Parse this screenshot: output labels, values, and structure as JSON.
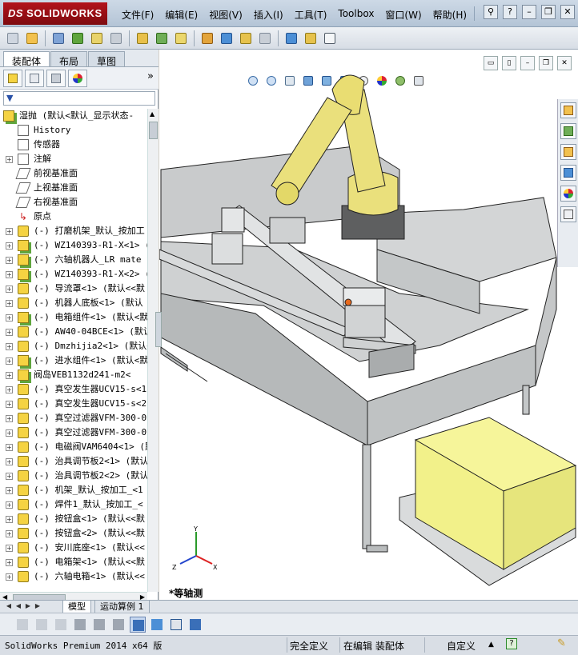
{
  "app": {
    "logo_text": "SOLIDWORKS",
    "logo_ds": "DS"
  },
  "menu": [
    "文件(F)",
    "编辑(E)",
    "视图(V)",
    "插入(I)",
    "工具(T)",
    "Toolbox",
    "窗口(W)",
    "帮助(H)"
  ],
  "panel": {
    "tabs": [
      "装配体",
      "布局",
      "草图"
    ],
    "active_tab": 0
  },
  "tree": {
    "root": "湿抛 (默认<默认_显示状态-",
    "items": [
      {
        "label": "History",
        "icon": "history-icon",
        "expand": ""
      },
      {
        "label": "传感器",
        "icon": "sensor-icon",
        "expand": ""
      },
      {
        "label": "注解",
        "icon": "annotation-icon",
        "expand": "+"
      },
      {
        "label": "前视基准面",
        "icon": "plane-icon",
        "expand": ""
      },
      {
        "label": "上视基准面",
        "icon": "plane-icon",
        "expand": ""
      },
      {
        "label": "右视基准面",
        "icon": "plane-icon",
        "expand": ""
      },
      {
        "label": "原点",
        "icon": "origin-icon",
        "expand": ""
      },
      {
        "label": "(-) 打磨机架_默认_按加工",
        "icon": "part-icon",
        "expand": "+"
      },
      {
        "label": "(-) WZ140393-R1-X<1> (默",
        "icon": "assembly-icon",
        "expand": "+"
      },
      {
        "label": "(-) 六轴机器人_LR mate",
        "icon": "assembly-icon",
        "expand": "+"
      },
      {
        "label": "(-) WZ140393-R1-X<2> (默",
        "icon": "assembly-icon",
        "expand": "+"
      },
      {
        "label": "(-) 导流罩<1> (默认<<默",
        "icon": "part-icon",
        "expand": "+"
      },
      {
        "label": "(-) 机器人底板<1> (默认",
        "icon": "part-icon",
        "expand": "+"
      },
      {
        "label": "(-) 电箱组件<1> (默认<默",
        "icon": "assembly-icon",
        "expand": "+"
      },
      {
        "label": "(-) AW40-04BCE<1> (默认",
        "icon": "part-icon",
        "expand": "+"
      },
      {
        "label": "(-) Dmzhijia2<1> (默认<",
        "icon": "part-icon",
        "expand": "+"
      },
      {
        "label": "(-) 进水组件<1> (默认<默",
        "icon": "assembly-icon",
        "expand": "+"
      },
      {
        "label": "阀岛VEB1132d241-m2<",
        "icon": "assembly-icon",
        "expand": "+"
      },
      {
        "label": "(-) 真空发生器UCV15-s<1",
        "icon": "part-icon",
        "expand": "+"
      },
      {
        "label": "(-) 真空发生器UCV15-s<2",
        "icon": "part-icon",
        "expand": "+"
      },
      {
        "label": "(-) 真空过滤器VFM-300-0",
        "icon": "part-icon",
        "expand": "+"
      },
      {
        "label": "(-) 真空过滤器VFM-300-0",
        "icon": "part-icon",
        "expand": "+"
      },
      {
        "label": "(-) 电磁阀VAM6404<1> (默",
        "icon": "part-icon",
        "expand": "+"
      },
      {
        "label": "(-) 治具调节板2<1> (默认",
        "icon": "part-icon",
        "expand": "+"
      },
      {
        "label": "(-) 治具调节板2<2> (默认",
        "icon": "part-icon",
        "expand": "+"
      },
      {
        "label": "(-) 机架_默认_按加工_<1",
        "icon": "part-icon",
        "expand": "+"
      },
      {
        "label": "(-) 焊件1_默认_按加工_<",
        "icon": "part-icon",
        "expand": "+"
      },
      {
        "label": "(-) 按钮盒<1> (默认<<默",
        "icon": "part-icon",
        "expand": "+"
      },
      {
        "label": "(-) 按钮盒<2> (默认<<默",
        "icon": "part-icon",
        "expand": "+"
      },
      {
        "label": "(-) 安川底座<1> (默认<<",
        "icon": "part-icon",
        "expand": "+"
      },
      {
        "label": "(-) 电箱架<1> (默认<<默",
        "icon": "part-icon",
        "expand": "+"
      },
      {
        "label": "(-) 六轴电箱<1> (默认<<",
        "icon": "part-icon",
        "expand": "+"
      }
    ]
  },
  "graphics": {
    "view_name": "*等轴测",
    "triad": {
      "x": "X",
      "y": "Y",
      "z": "Z"
    }
  },
  "bottom_tabs": [
    "模型",
    "运动算例 1"
  ],
  "status": {
    "product": "SolidWorks Premium 2014 x64 版",
    "definition": "完全定义",
    "editing": "在编辑 装配体",
    "units": "自定义",
    "units_arrow": "▲",
    "help": "?"
  },
  "colors": {
    "accent_red": "#b3131b",
    "robot_yellow": "#eae07c",
    "box_yellow": "#f2f18a",
    "frame_grey": "#b9bcbd"
  }
}
